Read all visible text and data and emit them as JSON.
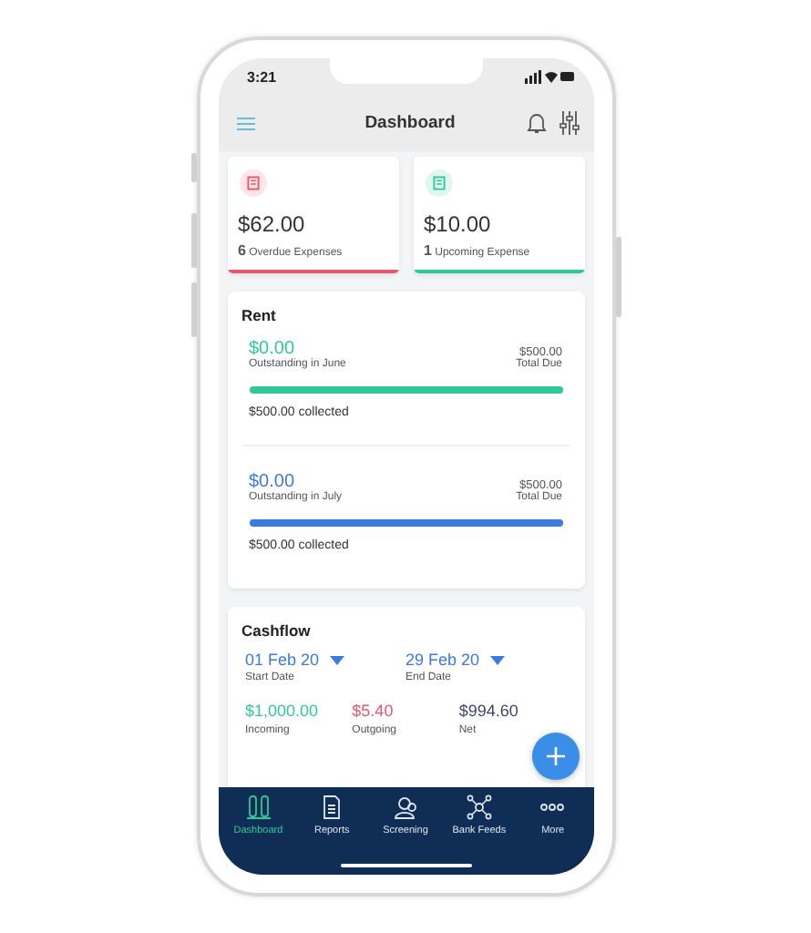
{
  "status_bar": {
    "time": "3:21"
  },
  "header": {
    "title": "Dashboard"
  },
  "summary_cards": [
    {
      "amount": "$62.00",
      "label": "**6** Overdue Expenses",
      "color": "#e8566c"
    },
    {
      "amount": "$10.00",
      "label": "**1** Upcoming Expense",
      "color": "#2ec99a"
    }
  ],
  "rent": {
    "title": "Rent",
    "periods": [
      {
        "outstanding": "$0.00",
        "outstanding_label": "Outstanding in June",
        "total": "$500.00",
        "total_label": "Total Due",
        "level": 1,
        "color": "#2ec99a",
        "collected": "$500.00 collected"
      },
      {
        "outstanding": "$0.00",
        "outstanding_label": "Outstanding in July",
        "total": "$500.00",
        "total_label": "Total Due",
        "level": 1,
        "color": "#3a7be0",
        "collected": "$500.00 collected"
      }
    ]
  },
  "cashflow": {
    "title": "Cashflow",
    "start_date": "01 Feb 20",
    "start_label": "Start Date",
    "end_date": "29 Feb 20",
    "end_label": "End Date",
    "figures": [
      {
        "value": "$1,000.00",
        "label": "Incoming",
        "color": "#2ec99a"
      },
      {
        "value": "$5.40",
        "label": "Outgoing",
        "color": "#e8566c"
      },
      {
        "value": "$994.60",
        "label": "Net",
        "color": "#3b4a6b"
      }
    ]
  },
  "tab_bar": [
    {
      "label": "Dashboard",
      "selected": true
    },
    {
      "label": "Reports",
      "selected": false
    },
    {
      "label": "Screening",
      "selected": false
    },
    {
      "label": "Bank Feeds",
      "selected": false
    },
    {
      "label": "More",
      "selected": false
    }
  ]
}
